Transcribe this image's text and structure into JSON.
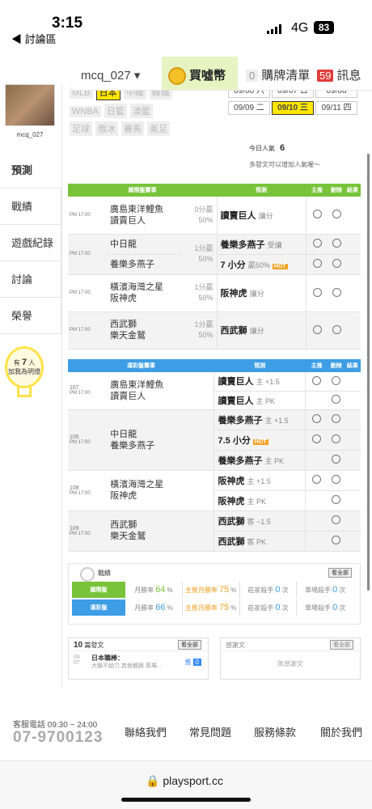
{
  "status": {
    "time": "3:15",
    "back": "◀ 討論區",
    "network": "4G",
    "battery": "83"
  },
  "topnav": {
    "user": "mcq_027 ▾",
    "coin": "買噓幣",
    "cart_count": "0",
    "cart": "購牌清單",
    "msg_count": "59",
    "msg": "訊息"
  },
  "profile": {
    "name": "mcq_027"
  },
  "sidenav": [
    "預測",
    "戰績",
    "遊戲紀錄",
    "討論",
    "榮譽"
  ],
  "bulb": {
    "pre": "有",
    "count": "7",
    "post": "人",
    "line2": "加我為明燈"
  },
  "tags": {
    "row1": [
      "MLB",
      "日本",
      "中職",
      "韓職"
    ],
    "row2": [
      "WNBA",
      "日籃",
      "澳籃"
    ],
    "row3": [
      "足球",
      "俄冰",
      "賽馬",
      "美足"
    ]
  },
  "dates": {
    "row1": [
      "09/06 六",
      "09/07 日",
      "09/08"
    ],
    "row2": [
      "09/09 二",
      "09/10 三",
      "09/11 四"
    ]
  },
  "popularity": {
    "label": "今日人氣",
    "value": "6",
    "hint": "多發文可以增加人氣喔～"
  },
  "intl": {
    "headers": [
      "國際盤賽事",
      "預測",
      "主推",
      "刪除",
      "結果"
    ],
    "rows": [
      {
        "time": "PM 17:00",
        "team1": "廣島東洋鯉魚",
        "team2": "讀賣巨人",
        "odds1": "0分贏",
        "odds2": "50%",
        "pick": "讀賣巨人",
        "pick_type": "讓分"
      },
      {
        "time": "PM 17:00",
        "team1": "中日龍",
        "team2": "養樂多燕子",
        "odds1": "1分贏",
        "odds2": "50%",
        "pick": "養樂多燕子",
        "pick_type": "受讓",
        "pick2": "7 小分",
        "pick2_type": "贏50%",
        "hot": "HOT"
      },
      {
        "time": "PM 17:00",
        "team1": "橫濱海灣之星",
        "team2": "阪神虎",
        "odds1": "1分贏",
        "odds2": "50%",
        "pick": "阪神虎",
        "pick_type": "讓分"
      },
      {
        "time": "PM 17:00",
        "team1": "西武獅",
        "team2": "樂天金鷲",
        "odds1": "1分贏",
        "odds2": "50%",
        "pick": "西武獅",
        "pick_type": "讓分"
      }
    ]
  },
  "lottery": {
    "headers": [
      "運彩盤賽事",
      "預測",
      "主推",
      "刪除",
      "結果"
    ],
    "rows": [
      {
        "no": "107",
        "time": "PM 17:00",
        "team1": "廣島東洋鯉魚",
        "team2": "讀賣巨人",
        "picks": [
          {
            "p": "讀賣巨人",
            "t": "主 +1.5"
          },
          {
            "p": "讀賣巨人",
            "t": "主 PK"
          }
        ]
      },
      {
        "no": "106",
        "time": "PM 17:00",
        "team1": "中日龍",
        "team2": "養樂多燕子",
        "picks": [
          {
            "p": "養樂多燕子",
            "t": "主 +1.5"
          },
          {
            "p": "7.5 小分",
            "t": "HOT"
          },
          {
            "p": "養樂多燕子",
            "t": "主 PK"
          }
        ]
      },
      {
        "no": "108",
        "time": "PM 17:00",
        "team1": "橫濱海灣之星",
        "team2": "阪神虎",
        "picks": [
          {
            "p": "阪神虎",
            "t": "主 +1.5"
          },
          {
            "p": "阪神虎",
            "t": "主 PK"
          }
        ]
      },
      {
        "no": "109",
        "time": "PM 17:00",
        "team1": "西武獅",
        "team2": "樂天金鷲",
        "picks": [
          {
            "p": "西武獅",
            "t": "客 −1.5"
          },
          {
            "p": "西武獅",
            "t": "客 PK"
          }
        ]
      }
    ]
  },
  "stats": {
    "title": "戰績",
    "all": "看全部",
    "intl": {
      "label": "國際盤",
      "c1a": "月勝率",
      "c1b": "64",
      "c1c": "%",
      "c2a": "主推月勝率",
      "c2b": "75",
      "c2c": "%",
      "c3a": "莊家殺手",
      "c3b": "0",
      "c3c": "次",
      "c4a": "單場殺手",
      "c4b": "0",
      "c4c": "次"
    },
    "lot": {
      "label": "運彩盤",
      "c1a": "月勝率",
      "c1b": "66",
      "c1c": "%",
      "c2a": "主推月勝率",
      "c2b": "75",
      "c2c": "%",
      "c3a": "莊家殺手",
      "c3b": "0",
      "c3c": "次",
      "c4a": "單場殺手",
      "c4b": "0",
      "c4c": "次"
    }
  },
  "follow": {
    "count": "10",
    "label": "篇發文",
    "all": "看全部",
    "date1": "09",
    "date2": "07",
    "title": "日本職棒：",
    "desc": "大聯不給力 其他都跟 英場...",
    "tag": "推",
    "tag_n": "0"
  },
  "fans": {
    "label": "感謝文",
    "all": "看全部",
    "empty": "無感謝文"
  },
  "footer": {
    "tel": "客服電話 09:30 ~ 24:00",
    "num": "07-9700123",
    "links": [
      "聯絡我們",
      "常見問題",
      "服務條款",
      "關於我們"
    ]
  },
  "url": "🔒 playsport.cc",
  "colors": {
    "intl": "#78c33a",
    "lottery": "#3d9de5",
    "selected": "#ffe500"
  }
}
